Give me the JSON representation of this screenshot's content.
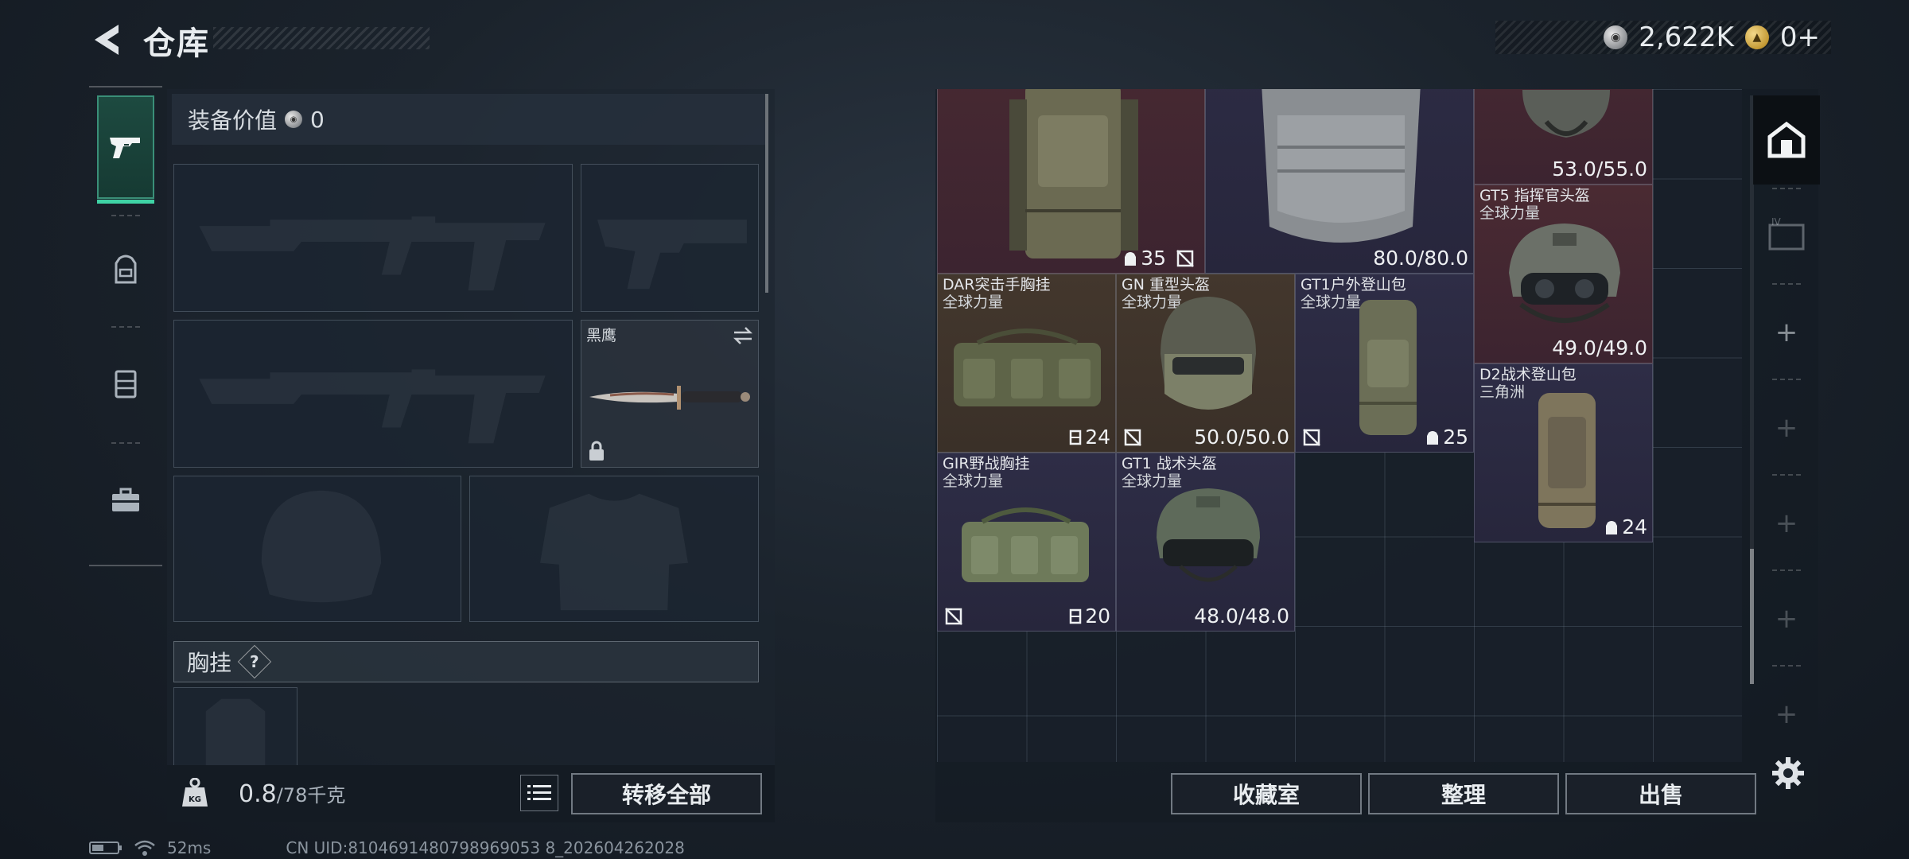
{
  "header": {
    "title": "仓库",
    "currencies": [
      {
        "icon": "silver-coin-icon",
        "value": "2,622K"
      },
      {
        "icon": "gold-coin-icon",
        "value": "0+"
      }
    ]
  },
  "tabs": [
    {
      "name": "weapon-tab",
      "icon": "pistol-icon",
      "active": true
    },
    {
      "name": "backpack-tab",
      "icon": "backpack-icon",
      "active": false
    },
    {
      "name": "vest-tab",
      "icon": "vest-icon",
      "active": false
    },
    {
      "name": "toolbox-tab",
      "icon": "toolbox-icon",
      "active": false
    }
  ],
  "equipment": {
    "value_label": "装备价值",
    "value": "0",
    "melee_name": "黑鹰",
    "chest_label": "胸挂",
    "help": "?"
  },
  "weight": {
    "current": "0.8",
    "max": "/78千克",
    "icon_text": "KG"
  },
  "buttons": {
    "transfer_all": "转移全部",
    "collection": "收藏室",
    "sort": "整理",
    "sell": "出售"
  },
  "items": [
    {
      "id": "bag-top",
      "name": "",
      "sub": "",
      "capacity": "35",
      "capacity_icon": "backpack-icon",
      "no_insure": true,
      "durability": "",
      "rarity": "red"
    },
    {
      "id": "armor-top",
      "name": "",
      "sub": "",
      "capacity": "",
      "no_insure": false,
      "durability": "80.0/80.0",
      "rarity": "purple"
    },
    {
      "id": "helmet-top",
      "name": "",
      "sub": "",
      "capacity": "",
      "no_insure": false,
      "durability": "53.0/55.0",
      "rarity": "red"
    },
    {
      "id": "gt5",
      "name": "GT5 指挥官头盔",
      "sub": "全球力量",
      "durability": "49.0/49.0",
      "rarity": "red"
    },
    {
      "id": "dar",
      "name": "DAR突击手胸挂",
      "sub": "全球力量",
      "capacity": "24",
      "capacity_icon": "vest-icon",
      "rarity": "brown"
    },
    {
      "id": "gn",
      "name": "GN 重型头盔",
      "sub": "全球力量",
      "durability": "50.0/50.0",
      "no_insure": true,
      "rarity": "brown"
    },
    {
      "id": "gt1bag",
      "name": "GT1户外登山包",
      "sub": "全球力量",
      "capacity": "25",
      "capacity_icon": "backpack-icon",
      "no_insure": true,
      "rarity": "purple"
    },
    {
      "id": "d2",
      "name": "D2战术登山包",
      "sub": "三角洲",
      "capacity": "24",
      "capacity_icon": "backpack-icon",
      "rarity": "purple"
    },
    {
      "id": "gir",
      "name": "GIR野战胸挂",
      "sub": "全球力量",
      "capacity": "20",
      "capacity_icon": "vest-icon",
      "no_insure": true,
      "rarity": "purple"
    },
    {
      "id": "gt1helm",
      "name": "GT1 战术头盔",
      "sub": "全球力量",
      "durability": "48.0/48.0",
      "rarity": "purple"
    }
  ],
  "side_panel": {
    "buttons": [
      "warehouse-icon",
      "container-icon",
      "add-icon",
      "add-icon",
      "add-icon",
      "add-icon",
      "add-icon"
    ]
  },
  "status": {
    "ping": "52ms",
    "uid": "CN UID:8104691480798969053 8_202604262028"
  },
  "colors": {
    "accent": "#3fd3a5",
    "rarity_red": "#4a2a32",
    "rarity_purple": "#2e2d46",
    "rarity_brown": "#43372d"
  }
}
